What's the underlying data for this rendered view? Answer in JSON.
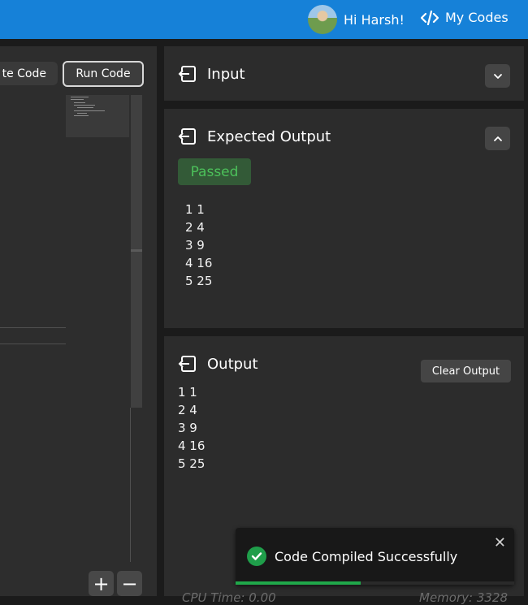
{
  "header": {
    "greeting": "Hi Harsh!",
    "my_codes_label": "My Codes",
    "accent_color": "#1681d8"
  },
  "editor": {
    "complete_code_label": "te Code",
    "run_code_label": "Run Code",
    "zoom_in_label": "+",
    "zoom_out_label": "−"
  },
  "input_panel": {
    "title": "Input",
    "icon": "file-export-icon",
    "toggle_icon": "chevron-down-icon"
  },
  "expected_panel": {
    "title": "Expected Output",
    "icon": "file-export-icon",
    "toggle_icon": "chevron-up-icon",
    "status": "Passed",
    "status_color": "#4cc05a",
    "lines": [
      "1 1",
      "2 4",
      "3 9",
      "4 16",
      "5 25"
    ]
  },
  "output_panel": {
    "title": "Output",
    "icon": "file-export-icon",
    "clear_label": "Clear Output",
    "lines": [
      "1 1",
      "2 4",
      "3 9",
      "4 16",
      "5 25"
    ],
    "cpu_time": "CPU Time: 0.00",
    "memory": "Memory: 3328"
  },
  "toast": {
    "message": "Code Compiled Successfully",
    "icon": "check-circle-icon",
    "close_icon": "close-icon",
    "progress_fraction": 0.45
  }
}
